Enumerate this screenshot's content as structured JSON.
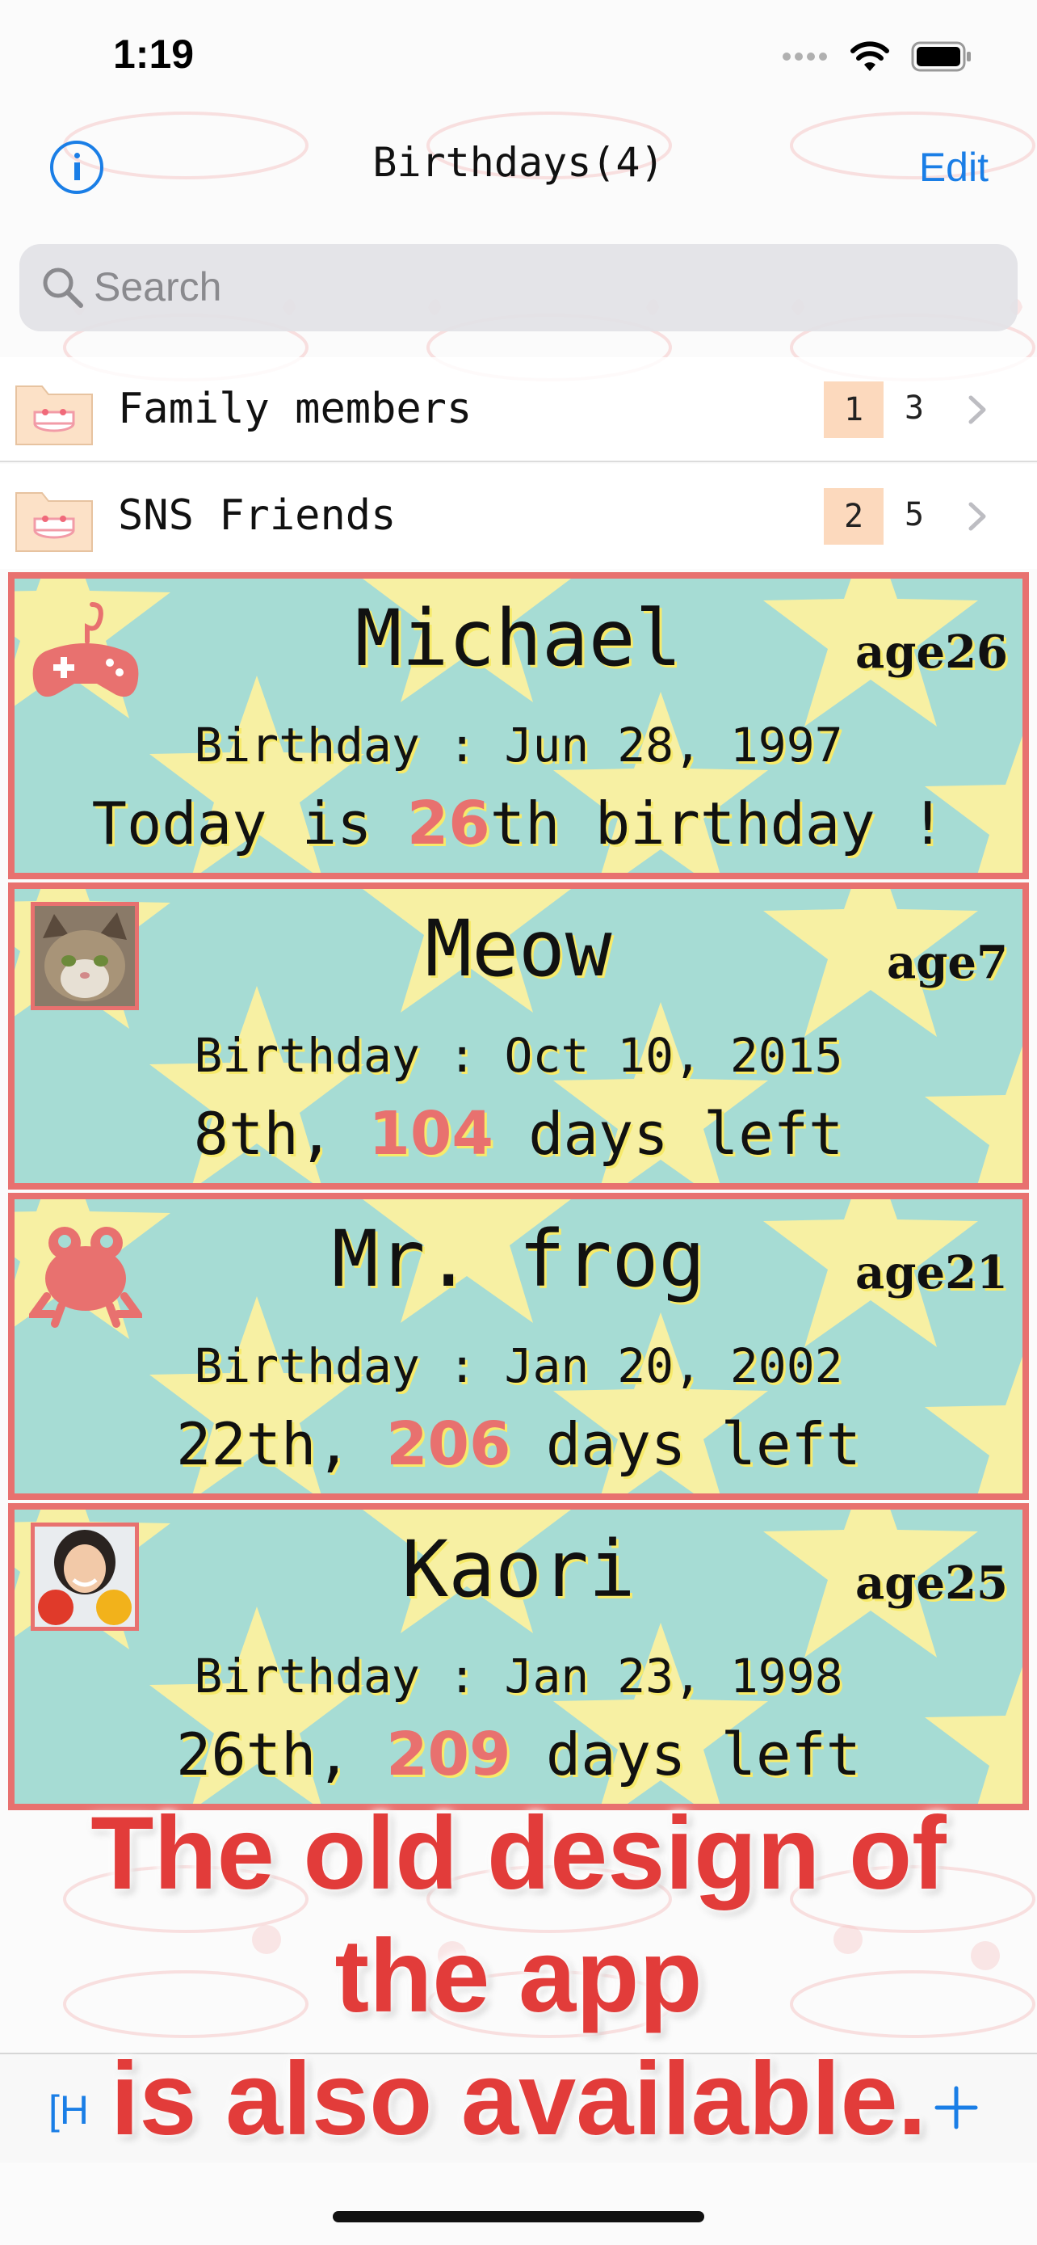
{
  "status_bar": {
    "time": "1:19"
  },
  "nav": {
    "title": "Birthdays(4)",
    "edit_label": "Edit",
    "info_icon": "info-icon"
  },
  "search": {
    "placeholder": "Search"
  },
  "folders": [
    {
      "label": "Family members",
      "badge": "1",
      "count": "3"
    },
    {
      "label": "SNS Friends",
      "badge": "2",
      "count": "5"
    }
  ],
  "cards": [
    {
      "name": "Michael",
      "age": "age26",
      "birthday": "Birthday : Jun 28, 1997",
      "info_prefix": "Today is ",
      "info_number": "26",
      "info_suffix": "th birthday !",
      "icon": "gamepad-icon"
    },
    {
      "name": "Meow",
      "age": "age7",
      "birthday": "Birthday : Oct 10, 2015",
      "info_prefix": "8th, ",
      "info_number": "104",
      "info_suffix": " days left",
      "icon": "cat-photo"
    },
    {
      "name": "Mr. frog",
      "age": "age21",
      "birthday": "Birthday : Jan 20, 2002",
      "info_prefix": "22th, ",
      "info_number": "206",
      "info_suffix": " days left",
      "icon": "frog-icon"
    },
    {
      "name": "Kaori",
      "age": "age25",
      "birthday": "Birthday : Jan 23, 1998",
      "info_prefix": "26th, ",
      "info_number": "209",
      "info_suffix": " days left",
      "icon": "person-photo"
    }
  ],
  "caption": {
    "line1": "The old design of",
    "line2": "the app",
    "line3": "is also available."
  },
  "toolbar": {
    "left_label": "[H",
    "add_icon": "plus-icon"
  },
  "colors": {
    "accent": "#1a7ee6",
    "card_border": "#e8716f",
    "card_bg": "#a6dcd4",
    "star": "#f7f0a3",
    "caption": "#e23c3a"
  }
}
